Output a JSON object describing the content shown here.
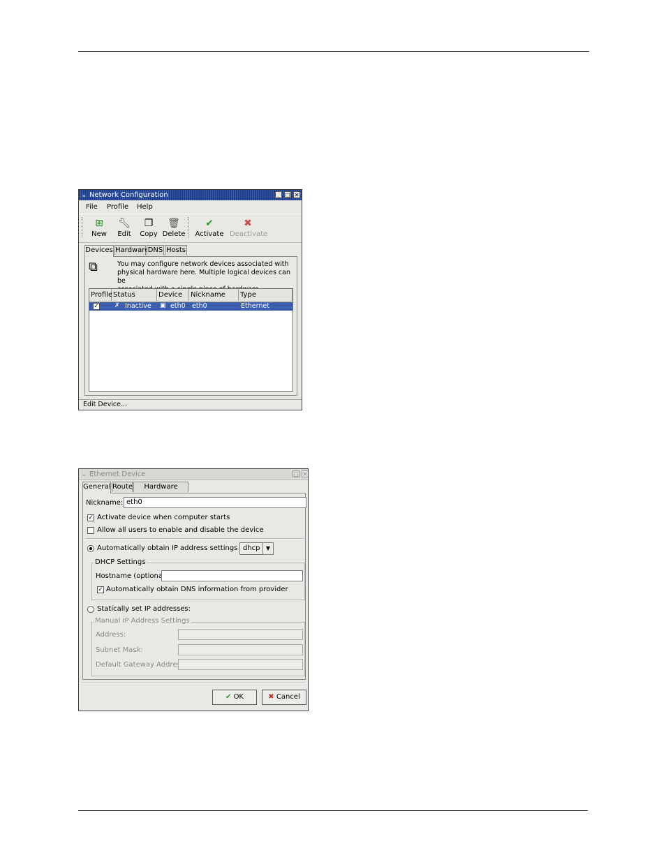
{
  "netconf": {
    "title": "Network Configuration",
    "menu": [
      "File",
      "Profile",
      "Help"
    ],
    "toolbar": {
      "new": "New",
      "edit": "Edit",
      "copy": "Copy",
      "delete": "Delete",
      "activate": "Activate",
      "deactivate": "Deactivate"
    },
    "tabs": [
      "Devices",
      "Hardware",
      "DNS",
      "Hosts"
    ],
    "info": [
      "You may configure network devices associated with",
      "physical hardware here.  Multiple logical devices can be",
      "associated with a single piece of hardware."
    ],
    "columns": [
      "Profile",
      "Status",
      "Device",
      "Nickname",
      "Type"
    ],
    "row": {
      "profile": "✓",
      "status": "Inactive",
      "device": "eth0",
      "nickname": "eth0",
      "type": "Ethernet"
    },
    "statusbar": "Edit Device..."
  },
  "ethdev": {
    "title": "Ethernet Device",
    "tabs": [
      "General",
      "Route",
      "Hardware Device"
    ],
    "nickname_label": "Nickname:",
    "nickname_value": "eth0",
    "activate_on_start": "Activate device when computer starts",
    "allow_users": "Allow all users to enable and disable the device",
    "auto_ip": "Automatically obtain IP address settings with:",
    "auto_ip_method": "dhcp",
    "dhcp_group": "DHCP Settings",
    "hostname_label": "Hostname (optional):",
    "hostname_value": "",
    "auto_dns": "Automatically obtain DNS information from provider",
    "static_ip": "Statically set IP addresses:",
    "manual_group": "Manual IP Address Settings",
    "address_label": "Address:",
    "subnet_label": "Subnet Mask:",
    "gateway_label": "Default Gateway Address:",
    "ok": "OK",
    "cancel": "Cancel"
  }
}
